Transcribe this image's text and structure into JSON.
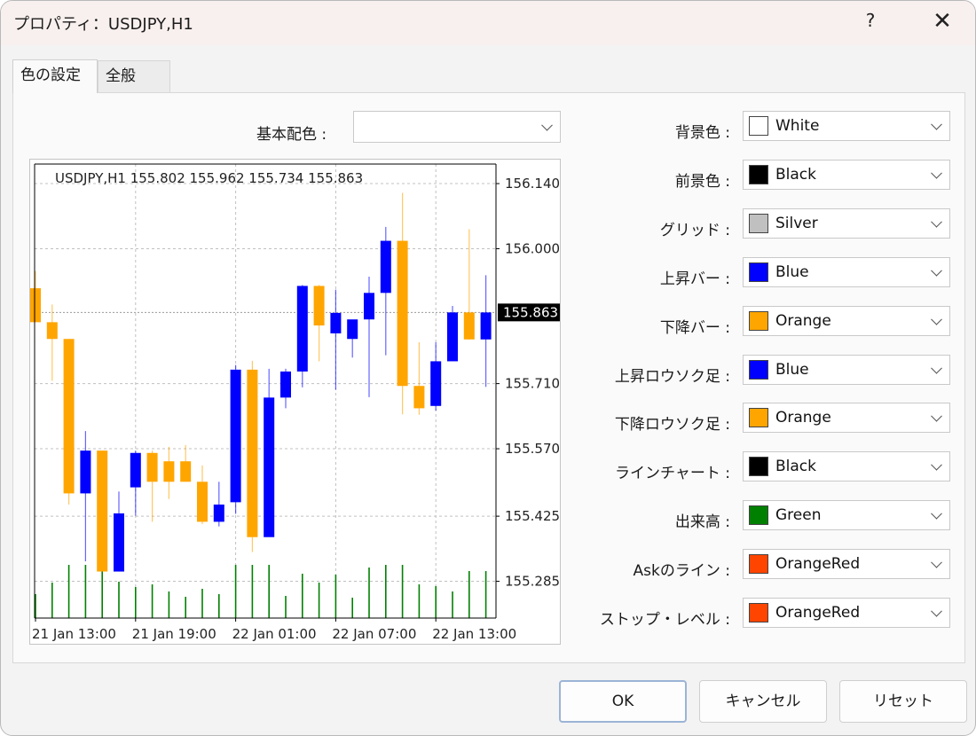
{
  "window": {
    "title": "プロパティ：USDJPY,H1",
    "help_label": "?",
    "close_label": "✕"
  },
  "tabs": [
    {
      "label": "色の設定",
      "active": true
    },
    {
      "label": "全般",
      "active": false
    }
  ],
  "base_scheme": {
    "label": "基本配色 :",
    "value": ""
  },
  "properties": [
    {
      "label": "背景色 :",
      "value": "White",
      "color": "#ffffff"
    },
    {
      "label": "前景色 :",
      "value": "Black",
      "color": "#000000"
    },
    {
      "label": "グリッド :",
      "value": "Silver",
      "color": "#c0c0c0"
    },
    {
      "label": "上昇バー :",
      "value": "Blue",
      "color": "#0000ff"
    },
    {
      "label": "下降バー :",
      "value": "Orange",
      "color": "#ffa500"
    },
    {
      "label": "上昇ロウソク足 :",
      "value": "Blue",
      "color": "#0000ff"
    },
    {
      "label": "下降ロウソク足 :",
      "value": "Orange",
      "color": "#ffa500"
    },
    {
      "label": "ラインチャート :",
      "value": "Black",
      "color": "#000000"
    },
    {
      "label": "出来高 :",
      "value": "Green",
      "color": "#008000"
    },
    {
      "label": "Askのライン :",
      "value": "OrangeRed",
      "color": "#ff4500"
    },
    {
      "label": "ストップ・レベル :",
      "value": "OrangeRed",
      "color": "#ff4500"
    }
  ],
  "buttons": {
    "ok": "OK",
    "cancel": "キャンセル",
    "reset": "リセット"
  },
  "chart_data": {
    "type": "candlestick",
    "symbol_label": "USDJPY,H1  155.802 155.962 155.734 155.863",
    "y_ticks": [
      156.14,
      156.0,
      155.71,
      155.57,
      155.425,
      155.285
    ],
    "current_price": 155.863,
    "ylim": [
      155.206,
      156.182
    ],
    "x_tick_labels": [
      "21 Jan 13:00",
      "21 Jan 19:00",
      "22 Jan 01:00",
      "22 Jan 07:00",
      "22 Jan 13:00"
    ],
    "x_tick_indices": [
      0,
      6,
      12,
      18,
      24
    ],
    "colors": {
      "up": "#0000ff",
      "down": "#ffa500",
      "grid": "#c0c0c0",
      "volume": "#008000",
      "frame": "#000000"
    },
    "candles": [
      {
        "o": 155.915,
        "h": 155.952,
        "l": 155.86,
        "c": 155.842
      },
      {
        "o": 155.842,
        "h": 155.88,
        "l": 155.716,
        "c": 155.806
      },
      {
        "o": 155.806,
        "h": 155.806,
        "l": 155.45,
        "c": 155.474
      },
      {
        "o": 155.474,
        "h": 155.608,
        "l": 155.328,
        "c": 155.566
      },
      {
        "o": 155.566,
        "h": 155.566,
        "l": 155.306,
        "c": 155.306
      },
      {
        "o": 155.306,
        "h": 155.478,
        "l": 155.306,
        "c": 155.431
      },
      {
        "o": 155.487,
        "h": 155.566,
        "l": 155.426,
        "c": 155.561
      },
      {
        "o": 155.561,
        "h": 155.566,
        "l": 155.413,
        "c": 155.499
      },
      {
        "o": 155.543,
        "h": 155.574,
        "l": 155.462,
        "c": 155.499
      },
      {
        "o": 155.543,
        "h": 155.578,
        "l": 155.499,
        "c": 155.499
      },
      {
        "o": 155.499,
        "h": 155.534,
        "l": 155.408,
        "c": 155.413
      },
      {
        "o": 155.413,
        "h": 155.499,
        "l": 155.403,
        "c": 155.45
      },
      {
        "o": 155.455,
        "h": 155.75,
        "l": 155.43,
        "c": 155.74
      },
      {
        "o": 155.74,
        "h": 155.759,
        "l": 155.348,
        "c": 155.38
      },
      {
        "o": 155.38,
        "h": 155.742,
        "l": 155.385,
        "c": 155.68
      },
      {
        "o": 155.68,
        "h": 155.742,
        "l": 155.657,
        "c": 155.736
      },
      {
        "o": 155.736,
        "h": 155.922,
        "l": 155.702,
        "c": 155.92
      },
      {
        "o": 155.92,
        "h": 155.922,
        "l": 155.758,
        "c": 155.835
      },
      {
        "o": 155.818,
        "h": 155.912,
        "l": 155.697,
        "c": 155.862
      },
      {
        "o": 155.806,
        "h": 155.839,
        "l": 155.766,
        "c": 155.848
      },
      {
        "o": 155.848,
        "h": 155.94,
        "l": 155.681,
        "c": 155.905
      },
      {
        "o": 155.905,
        "h": 156.047,
        "l": 155.771,
        "c": 156.017
      },
      {
        "o": 156.017,
        "h": 156.12,
        "l": 155.644,
        "c": 155.705
      },
      {
        "o": 155.705,
        "h": 155.799,
        "l": 155.643,
        "c": 155.657
      },
      {
        "o": 155.662,
        "h": 155.799,
        "l": 155.652,
        "c": 155.758
      },
      {
        "o": 155.758,
        "h": 155.877,
        "l": 155.766,
        "c": 155.863
      },
      {
        "o": 155.863,
        "h": 156.042,
        "l": 155.805,
        "c": 155.805
      },
      {
        "o": 155.805,
        "h": 155.943,
        "l": 155.703,
        "c": 155.863
      }
    ]
  }
}
